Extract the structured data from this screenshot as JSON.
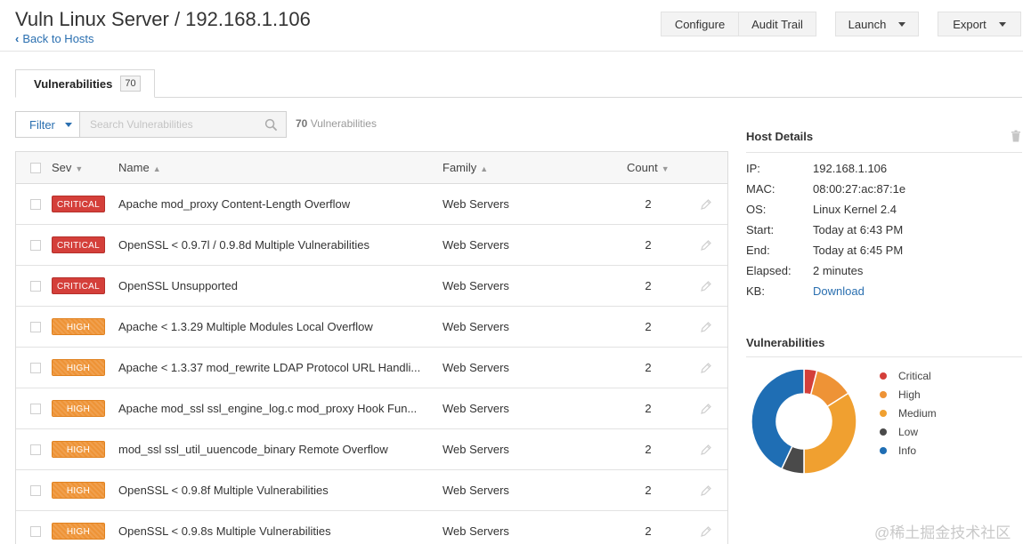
{
  "header": {
    "title": "Vuln Linux Server / 192.168.1.106",
    "back_label": "Back to Hosts",
    "buttons": {
      "configure": "Configure",
      "audit": "Audit Trail",
      "launch": "Launch",
      "export": "Export"
    }
  },
  "tab": {
    "label": "Vulnerabilities",
    "count": "70"
  },
  "toolbar": {
    "filter_label": "Filter",
    "search_placeholder": "Search Vulnerabilities",
    "count_number": "70",
    "count_suffix": " Vulnerabilities"
  },
  "table": {
    "headers": {
      "sev": "Sev",
      "name": "Name",
      "family": "Family",
      "count": "Count"
    },
    "rows": [
      {
        "severity": "CRITICAL",
        "level": "critical",
        "name": "Apache mod_proxy Content-Length Overflow",
        "family": "Web Servers",
        "count": "2"
      },
      {
        "severity": "CRITICAL",
        "level": "critical",
        "name": "OpenSSL < 0.9.7l / 0.9.8d Multiple Vulnerabilities",
        "family": "Web Servers",
        "count": "2"
      },
      {
        "severity": "CRITICAL",
        "level": "critical",
        "name": "OpenSSL Unsupported",
        "family": "Web Servers",
        "count": "2"
      },
      {
        "severity": "HIGH",
        "level": "high",
        "name": "Apache < 1.3.29 Multiple Modules Local Overflow",
        "family": "Web Servers",
        "count": "2"
      },
      {
        "severity": "HIGH",
        "level": "high",
        "name": "Apache < 1.3.37 mod_rewrite LDAP Protocol URL Handli...",
        "family": "Web Servers",
        "count": "2"
      },
      {
        "severity": "HIGH",
        "level": "high",
        "name": "Apache mod_ssl ssl_engine_log.c mod_proxy Hook Fun...",
        "family": "Web Servers",
        "count": "2"
      },
      {
        "severity": "HIGH",
        "level": "high",
        "name": "mod_ssl ssl_util_uuencode_binary Remote Overflow",
        "family": "Web Servers",
        "count": "2"
      },
      {
        "severity": "HIGH",
        "level": "high",
        "name": "OpenSSL < 0.9.8f Multiple Vulnerabilities",
        "family": "Web Servers",
        "count": "2"
      },
      {
        "severity": "HIGH",
        "level": "high",
        "name": "OpenSSL < 0.9.8s Multiple Vulnerabilities",
        "family": "Web Servers",
        "count": "2"
      }
    ]
  },
  "host_details": {
    "title": "Host Details",
    "fields": [
      {
        "label": "IP:",
        "value": "192.168.1.106"
      },
      {
        "label": "MAC:",
        "value": "08:00:27:ac:87:1e"
      },
      {
        "label": "OS:",
        "value": "Linux Kernel 2.4"
      },
      {
        "label": "Start:",
        "value": "Today at 6:43 PM"
      },
      {
        "label": "End:",
        "value": "Today at 6:45 PM"
      },
      {
        "label": "Elapsed:",
        "value": "2 minutes"
      },
      {
        "label": "KB:",
        "value": "Download",
        "link": true
      }
    ]
  },
  "vuln_summary": {
    "title": "Vulnerabilities",
    "legend": [
      {
        "label": "Critical",
        "color": "#d43f3a",
        "share": 0.04
      },
      {
        "label": "High",
        "color": "#ee9336",
        "share": 0.12
      },
      {
        "label": "Medium",
        "color": "#f0a030",
        "share": 0.34
      },
      {
        "label": "Low",
        "color": "#4a4a4a",
        "share": 0.07
      },
      {
        "label": "Info",
        "color": "#1f6eb4",
        "share": 0.43
      }
    ]
  },
  "watermark": "@稀土掘金技术社区"
}
